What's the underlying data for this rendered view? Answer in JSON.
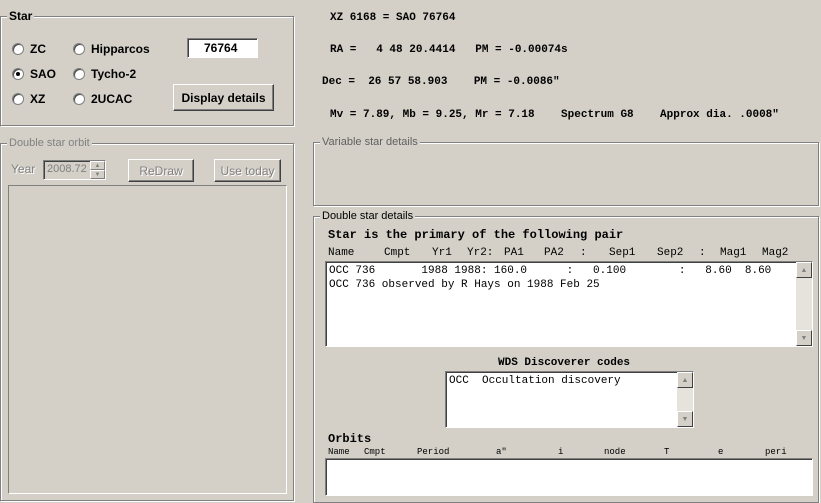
{
  "star_group": {
    "title": "Star",
    "radios": [
      {
        "label": "ZC",
        "selected": false
      },
      {
        "label": "SAO",
        "selected": true
      },
      {
        "label": "XZ",
        "selected": false
      },
      {
        "label": "Hipparcos",
        "selected": false
      },
      {
        "label": "Tycho-2",
        "selected": false
      },
      {
        "label": "2UCAC",
        "selected": false
      }
    ],
    "number_value": "76764",
    "display_button": "Display details"
  },
  "star_info": {
    "line1": "XZ 6168 = SAO 76764",
    "ra": "RA =   4 48 20.4414   PM = -0.00074s",
    "dec": "Dec =  26 57 58.903    PM = -0.0086\"",
    "mags": "Mv = 7.89, Mb = 9.25, Mr = 7.18    Spectrum G8    Approx dia. .0008\""
  },
  "orbit_group": {
    "title": "Double star orbit",
    "year_label": "Year",
    "year_value": "2008.72",
    "redraw_button": "ReDraw",
    "use_today_button": "Use today"
  },
  "variable_group": {
    "title": "Variable star details"
  },
  "double_group": {
    "title": "Double star details",
    "heading": "Star is the primary of the following pair",
    "columns": [
      "Name",
      "Cmpt",
      "Yr1",
      "Yr2:",
      "PA1",
      "PA2",
      ":",
      "Sep1",
      "Sep2",
      ":",
      "Mag1",
      "Mag2"
    ],
    "rows": [
      "OCC 736       1988 1988: 160.0      :   0.100        :   8.60  8.60",
      "OCC 736 observed by R Hays on 1988 Feb 25"
    ],
    "wds_title": "WDS Discoverer codes",
    "wds_rows": [
      "OCC  Occultation discovery"
    ],
    "orbits_title": "Orbits",
    "orbit_columns": [
      "Name",
      "Cmpt",
      "Period",
      "a\"",
      "i",
      "node",
      "T",
      "e",
      "peri"
    ]
  }
}
